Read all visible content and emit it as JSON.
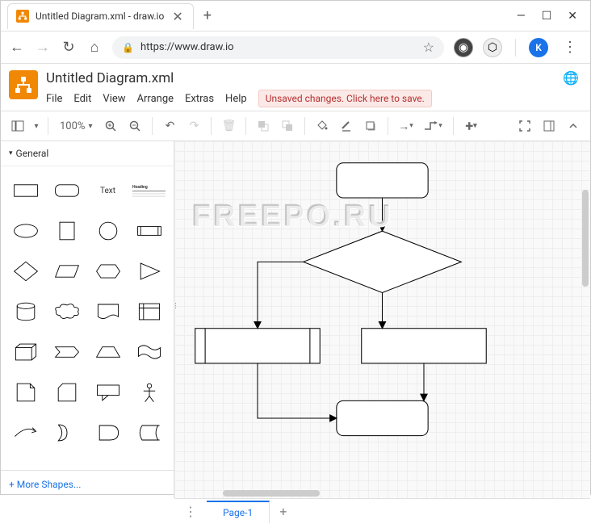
{
  "window": {
    "tab_title": "Untitled Diagram.xml - draw.io",
    "controls": {
      "min": "—",
      "max": "☐",
      "close": "✕"
    }
  },
  "browser": {
    "url": "https://www.draw.io",
    "user_initial": "K"
  },
  "app": {
    "title": "Untitled Diagram.xml",
    "menu": [
      "File",
      "Edit",
      "View",
      "Arrange",
      "Extras",
      "Help"
    ],
    "unsaved_message": "Unsaved changes. Click here to save."
  },
  "toolbar": {
    "zoom": "100%"
  },
  "sidebar": {
    "section": "General",
    "text_label": "Text",
    "heading_label": "Heading",
    "more_shapes": "+ More Shapes..."
  },
  "canvas": {
    "watermark": "FREEPO.RU"
  },
  "tabs": {
    "page1": "Page-1"
  }
}
